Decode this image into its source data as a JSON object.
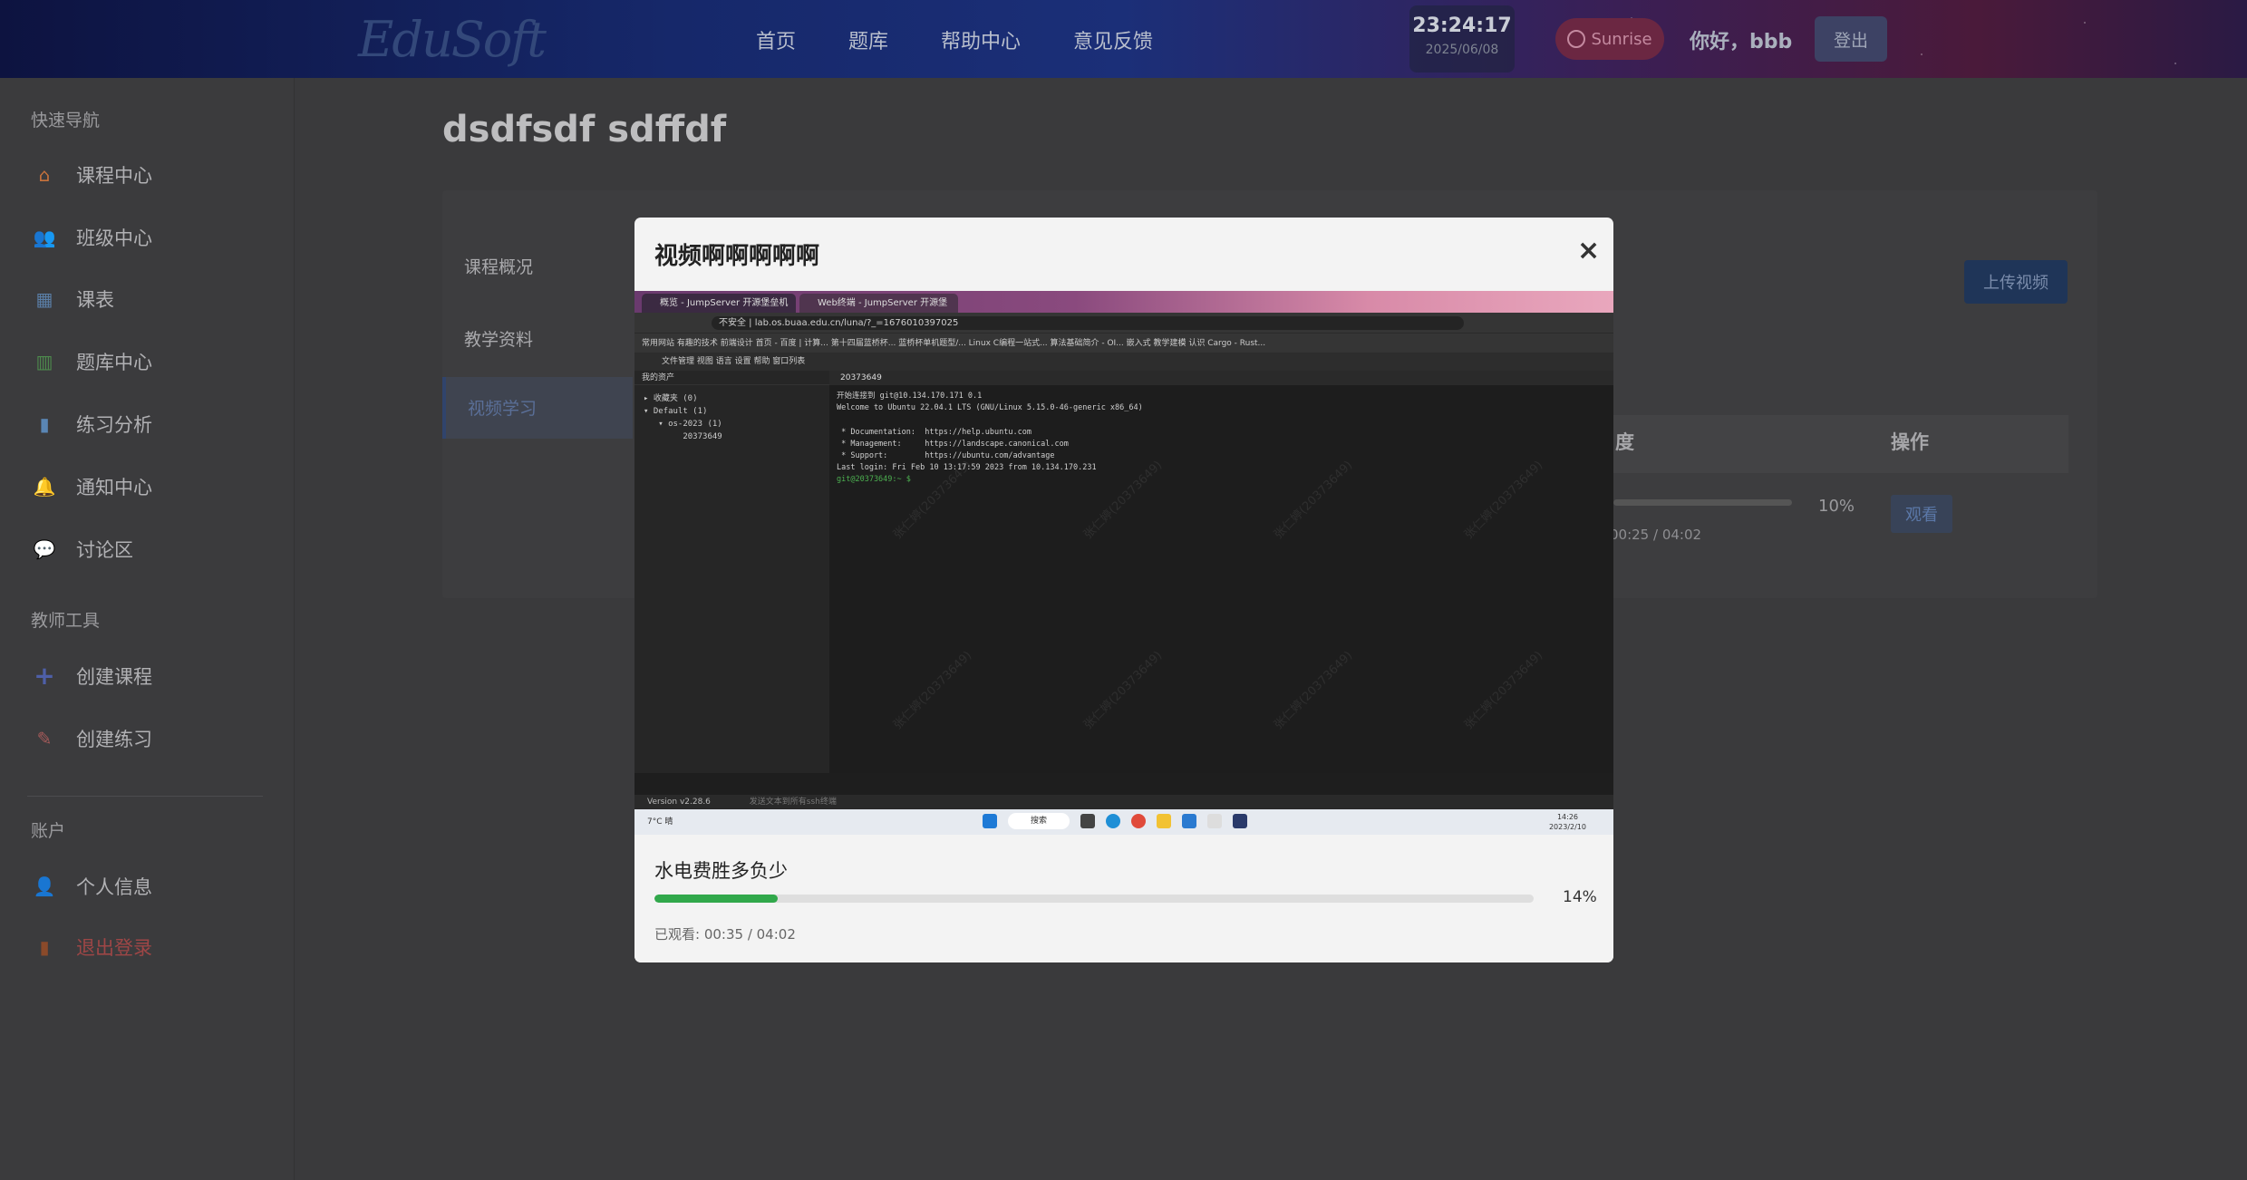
{
  "header": {
    "logo": "EduSoft",
    "nav": [
      "首页",
      "题库",
      "帮助中心",
      "意见反馈"
    ],
    "clock_time": "23:24:17",
    "clock_date": "2025/06/08",
    "theme_label": "Sunrise",
    "greeting": "你好，bbb",
    "logout": "登出"
  },
  "sidebar": {
    "sections": [
      {
        "title": "快速导航",
        "items": [
          {
            "label": "课程中心",
            "icon": "school-icon"
          },
          {
            "label": "班级中心",
            "icon": "users-icon"
          },
          {
            "label": "课表",
            "icon": "calendar-icon"
          },
          {
            "label": "题库中心",
            "icon": "books-icon"
          },
          {
            "label": "练习分析",
            "icon": "bar-chart-icon"
          },
          {
            "label": "通知中心",
            "icon": "bell-icon"
          },
          {
            "label": "讨论区",
            "icon": "chat-bubble-icon"
          }
        ]
      },
      {
        "title": "教师工具",
        "items": [
          {
            "label": "创建课程",
            "icon": "plus-icon"
          },
          {
            "label": "创建练习",
            "icon": "edit-icon"
          }
        ]
      },
      {
        "title": "账户",
        "items": [
          {
            "label": "个人信息",
            "icon": "user-icon"
          },
          {
            "label": "退出登录",
            "icon": "door-icon"
          }
        ]
      }
    ]
  },
  "page": {
    "title": "dsdfsdf sdffdf",
    "tabs": [
      "课程概况",
      "教学资料",
      "视频学习"
    ],
    "active_tab": "视频学习",
    "upload_button": "上传视频",
    "table_headers": [
      "度",
      "操作"
    ],
    "row": {
      "progress_pct": "10%",
      "progress_value": 0.1,
      "time": "00:25 / 04:02",
      "action": "观看"
    }
  },
  "modal": {
    "title": "视频啊啊啊啊啊",
    "close_symbol": "×",
    "video_name": "水电费胜多负少",
    "progress_value": 0.14,
    "progress_text": "14%",
    "watched_text": "已观看: 00:35 / 04:02"
  },
  "video_frame": {
    "browser_tabs": [
      "概览 - JumpServer 开源堡垒机",
      "Web终端 - JumpServer 开源堡"
    ],
    "url_warning": "不安全",
    "url": "lab.os.buaa.edu.cn/luna/?_=1676010397025",
    "bookmarks": "常用网站  有趣的技术  前端设计  首页 - 百度 | 计算...  第十四届蓝桥杯...  蓝桥杯单机题型/...  Linux C编程一站式...  算法基础简介 - OI...  嵌入式  教学建模  认识 Cargo - Rust...",
    "menu": "文件管理   视图   语言   设置   帮助   窗口列表",
    "tree_header": "我的资产",
    "tree_lines": [
      "▸ 收藏夹 (0)",
      "▾ Default (1)",
      "   ▾ os-2023 (1)",
      "        20373649"
    ],
    "term_tab": "20373649",
    "terminal_lines": [
      "开始连接到 git@10.134.170.171  0.1",
      "Welcome to Ubuntu 22.04.1 LTS (GNU/Linux 5.15.0-46-generic x86_64)",
      "",
      " * Documentation:  https://help.ubuntu.com",
      " * Management:     https://landscape.canonical.com",
      " * Support:        https://ubuntu.com/advantage",
      "Last login: Fri Feb 10 13:17:59 2023 from 10.134.170.231"
    ],
    "prompt": "git@20373649:~ $ ",
    "version": "Version v2.28.6",
    "status_hint": "发送文本到所有ssh终端",
    "weather": "7°C 晴",
    "taskbar_search": "搜索",
    "taskbar_time": "14:26",
    "taskbar_date": "2023/2/10",
    "watermark": "张仁婷(20373649)"
  }
}
